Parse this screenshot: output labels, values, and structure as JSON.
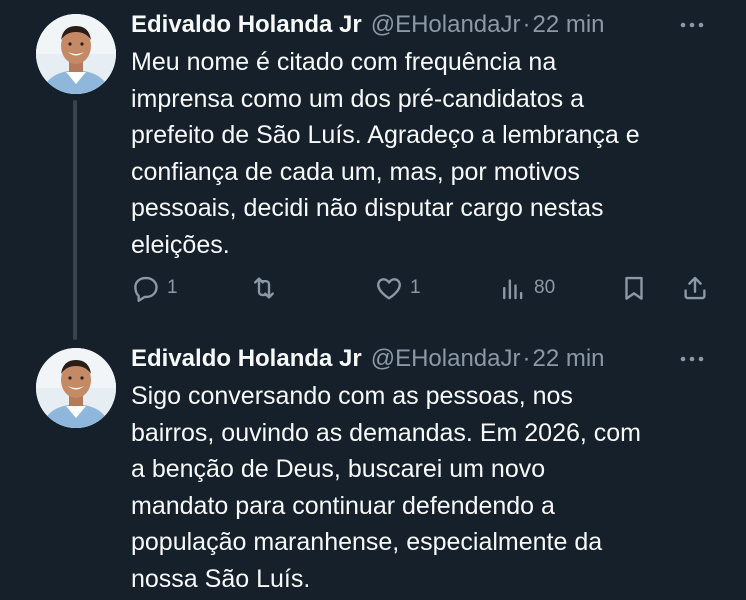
{
  "tweets": [
    {
      "author_name": "Edivaldo Holanda Jr",
      "handle": "@EHolandaJr",
      "separator": "·",
      "time": "22 min",
      "text": "Meu nome é citado com frequência na\nimprensa como um dos pré-candidatos a\nprefeito de São Luís. Agradeço a lembrança e\nconfiança de cada um, mas, por motivos\npessoais, decidi não disputar cargo nestas\neleições.",
      "replies": "1",
      "likes": "1",
      "views": "80"
    },
    {
      "author_name": "Edivaldo Holanda Jr",
      "handle": "@EHolandaJr",
      "separator": "·",
      "time": "22 min",
      "text": "Sigo conversando com as pessoas, nos\nbairros, ouvindo as demandas. Em 2026, com\na benção de Deus, buscarei um novo\nmandato para continuar defendendo a\npopulação  maranhense, especialmente da\nnossa São Luís."
    }
  ],
  "icons": {
    "reply": "reply-icon",
    "retweet": "retweet-icon",
    "like": "heart-icon",
    "views": "views-icon",
    "bookmark": "bookmark-icon",
    "share": "share-icon",
    "more": "more-icon"
  },
  "colors": {
    "background": "#15202b",
    "text_primary": "#f7f9f9",
    "text_secondary": "#8b98a5",
    "thread_line": "#38444d"
  }
}
